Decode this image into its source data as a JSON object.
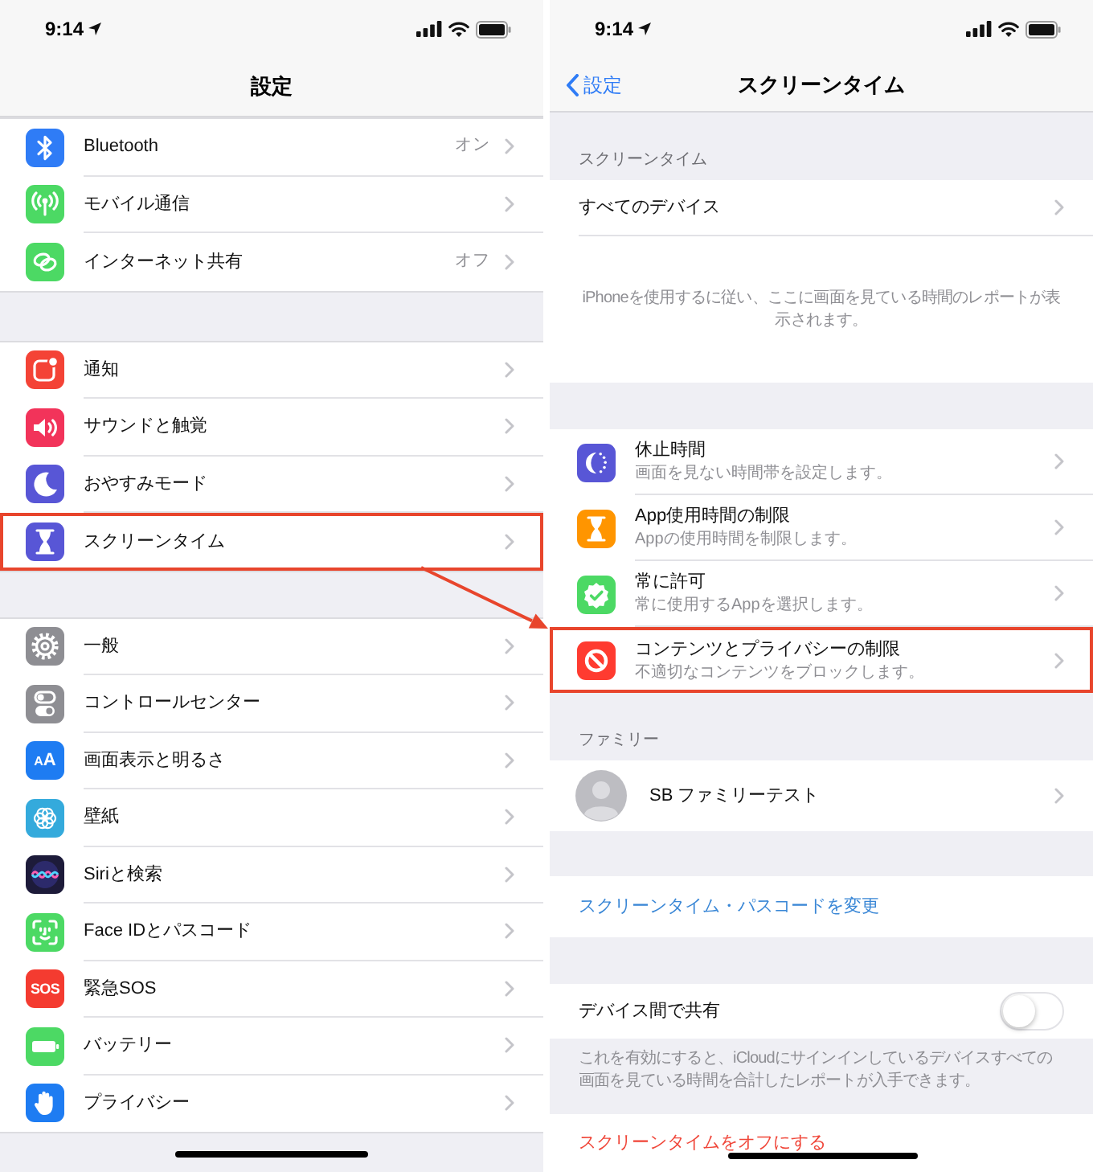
{
  "left_screen": {
    "status_bar": {
      "time": "9:14"
    },
    "title": "設定",
    "groups": [
      {
        "rows": [
          {
            "label": "Bluetooth",
            "value": "オン",
            "highlighted": false
          },
          {
            "label": "モバイル通信",
            "highlighted": false
          },
          {
            "label": "インターネット共有",
            "value": "オフ",
            "highlighted": false
          }
        ]
      },
      {
        "rows": [
          {
            "label": "通知",
            "highlighted": false
          },
          {
            "label": "サウンドと触覚",
            "highlighted": false
          },
          {
            "label": "おやすみモード",
            "highlighted": false
          },
          {
            "label": "スクリーンタイム",
            "highlighted": true
          }
        ]
      },
      {
        "rows": [
          {
            "label": "一般",
            "highlighted": false
          },
          {
            "label": "コントロールセンター",
            "highlighted": false
          },
          {
            "label": "画面表示と明るさ",
            "icon_text": "AA",
            "highlighted": false
          },
          {
            "label": "壁紙",
            "highlighted": false
          },
          {
            "label": "Siriと検索",
            "highlighted": false
          },
          {
            "label": "Face IDとパスコード",
            "highlighted": false
          },
          {
            "label": "緊急SOS",
            "icon_text": "SOS",
            "highlighted": false
          },
          {
            "label": "バッテリー",
            "highlighted": false
          },
          {
            "label": "プライバシー",
            "highlighted": false
          }
        ]
      }
    ]
  },
  "right_screen": {
    "status_bar": {
      "time": "9:14"
    },
    "back_label": "設定",
    "title": "スクリーンタイム",
    "section_header": "スクリーンタイム",
    "all_devices": "すべてのデバイス",
    "report_note": "iPhoneを使用するに従い、ここに画面を見ている時間のレポートが表示されます。",
    "features": [
      {
        "title": "休止時間",
        "subtitle": "画面を見ない時間帯を設定します。",
        "highlighted": false
      },
      {
        "title": "App使用時間の制限",
        "subtitle": "Appの使用時間を制限します。",
        "highlighted": false
      },
      {
        "title": "常に許可",
        "subtitle": "常に使用するAppを選択します。",
        "highlighted": false
      },
      {
        "title": "コンテンツとプライバシーの制限",
        "subtitle": "不適切なコンテンツをブロックします。",
        "highlighted": true
      }
    ],
    "family_header": "ファミリー",
    "family_members": [
      {
        "name": "SB ファミリーテスト"
      }
    ],
    "passcode_link": "スクリーンタイム・パスコードを変更",
    "share": {
      "label": "デバイス間で共有",
      "on": false
    },
    "share_note": "これを有効にすると、iCloudにサインインしているデバイスすべての画面を見ている時間を合計したレポートが入手できます。",
    "turn_off_link": "スクリーンタイムをオフにする"
  }
}
